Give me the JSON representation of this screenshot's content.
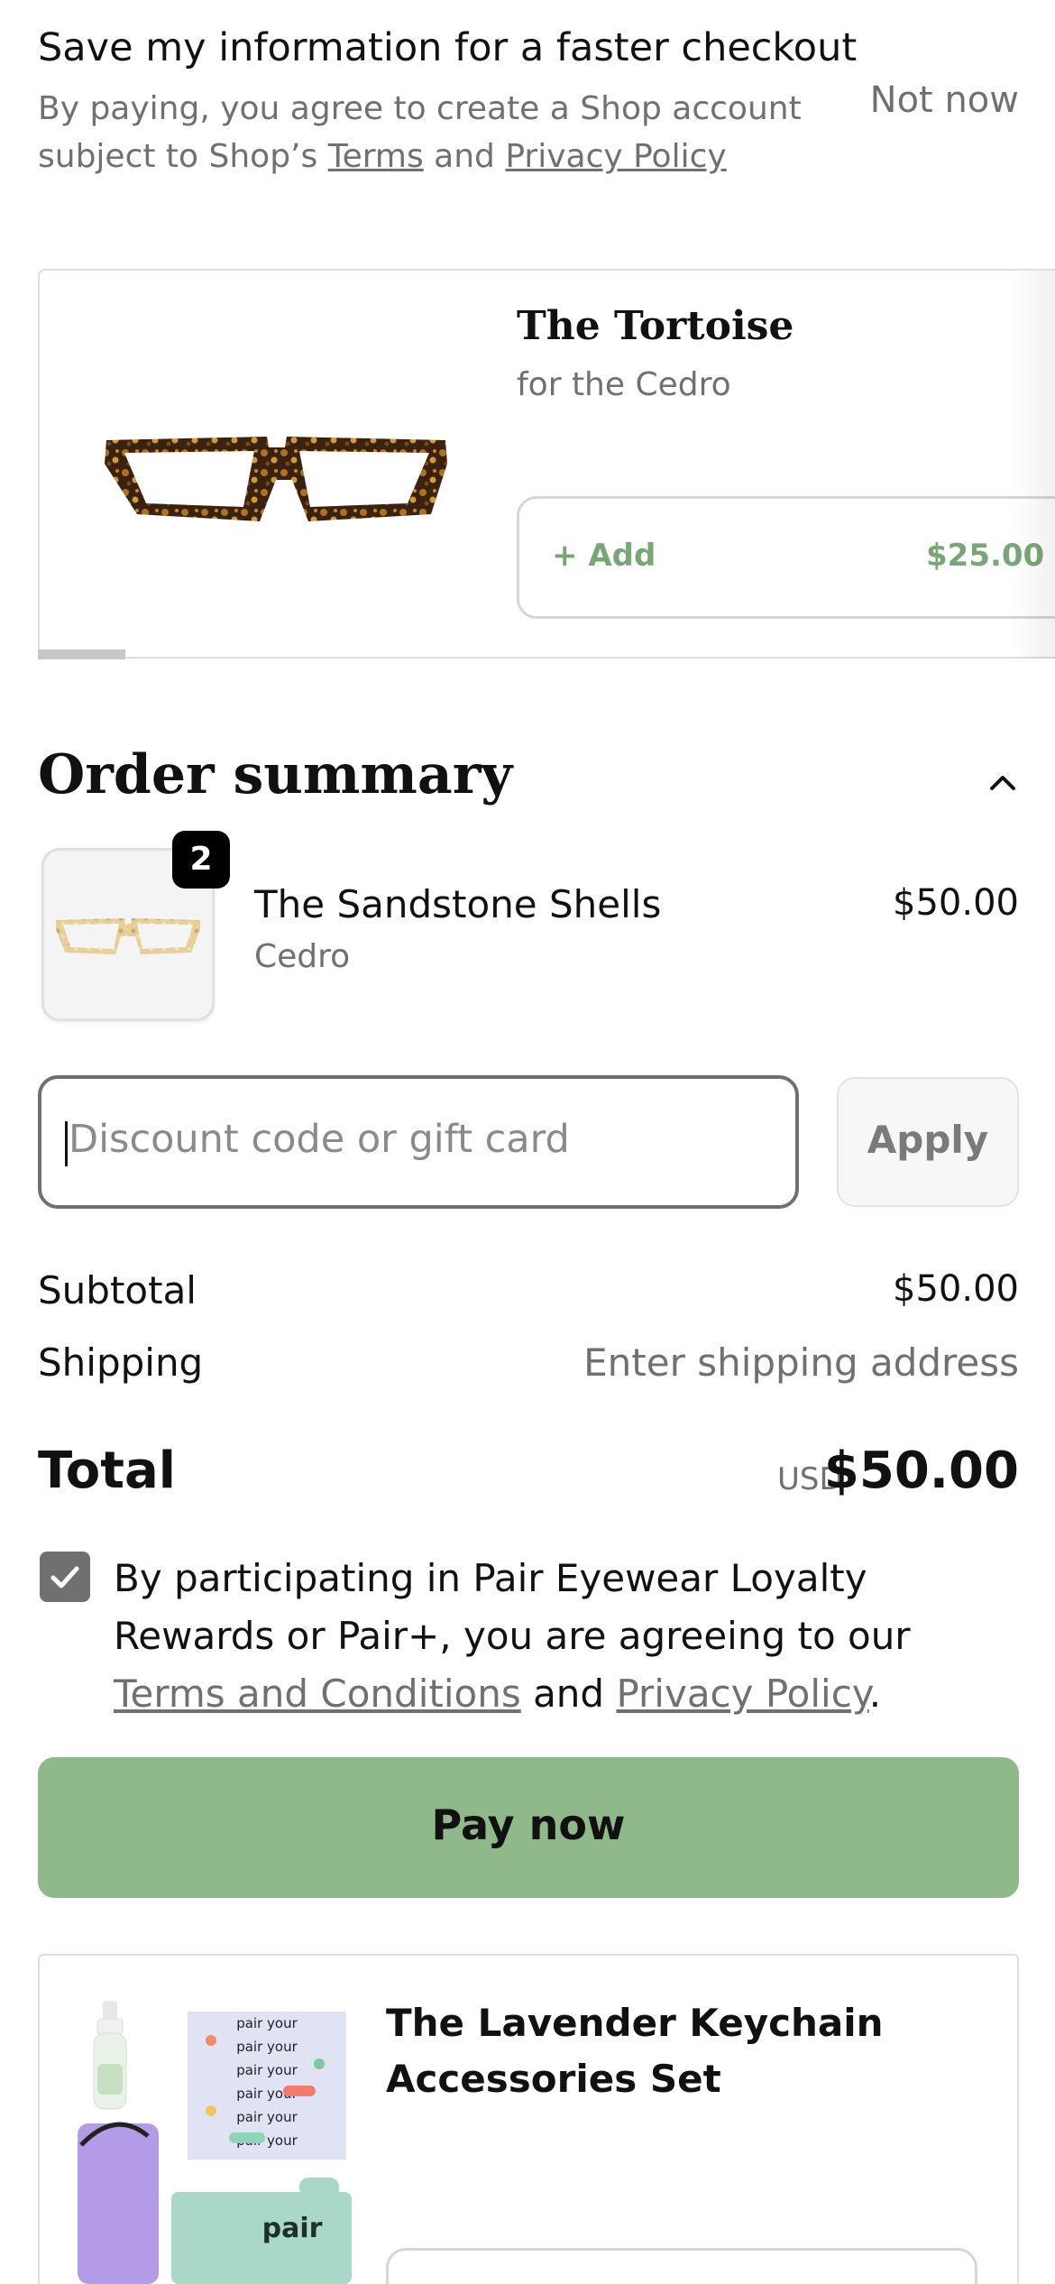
{
  "save_info": {
    "title": "Save my information for a faster checkout",
    "desc_prefix": "By paying, you agree to create a Shop account subject to Shop’s ",
    "terms_link": "Terms",
    "and": " and ",
    "privacy_link": "Privacy Policy",
    "not_now": "Not now"
  },
  "upsell": {
    "title": "The Tortoise",
    "subtitle": "for the Cedro",
    "add_label": "+ Add",
    "price": "$25.00"
  },
  "order_summary": {
    "title": "Order summary",
    "item": {
      "name": "The Sandstone Shells",
      "variant": "Cedro",
      "price": "$50.00",
      "quantity": "2"
    }
  },
  "discount": {
    "placeholder": "Discount code or gift card",
    "apply_label": "Apply"
  },
  "totals": {
    "subtotal_label": "Subtotal",
    "subtotal_value": "$50.00",
    "shipping_label": "Shipping",
    "shipping_value": "Enter shipping address",
    "total_label": "Total",
    "currency": "USD",
    "total_value": "$50.00"
  },
  "consent": {
    "checked": true,
    "text_prefix": "By participating in Pair Eyewear Loyalty Rewards or Pair+, you are agreeing to our ",
    "terms_link": "Terms and Conditions",
    "and": " and ",
    "privacy_link": "Privacy Policy",
    "suffix": "."
  },
  "pay_now": {
    "label": "Pay now",
    "color": "#8fb98b"
  },
  "upsell2": {
    "title": "The Lavender Keychain Accessories Set",
    "product_text_1": "pair your",
    "product_text_2": "pair"
  },
  "colors": {
    "accent_green": "#7aa677",
    "muted_text": "#707070"
  }
}
